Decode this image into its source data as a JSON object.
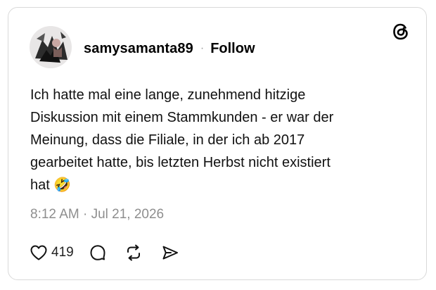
{
  "post": {
    "username": "samysamanta89",
    "separator": "·",
    "follow_label": "Follow",
    "body_lines": [
      "Ich hatte mal eine lange, zunehmend hitzige",
      "Diskussion mit einem Stammkunden - er war der",
      "Meinung, dass die Filiale, in der ich ab 2017",
      "gearbeitet hatte, bis letzten Herbst nicht existiert",
      "hat 🤣"
    ],
    "timestamp": "8:12 AM · Jul 21, 2026",
    "like_count": "419"
  },
  "icons": {
    "brand": "threads-logo-icon",
    "like": "heart-icon",
    "reply": "comment-icon",
    "repost": "repost-icon",
    "share": "send-icon"
  },
  "colors": {
    "text": "#000000",
    "muted": "#8e8e8e",
    "border": "#d9d9d9"
  }
}
